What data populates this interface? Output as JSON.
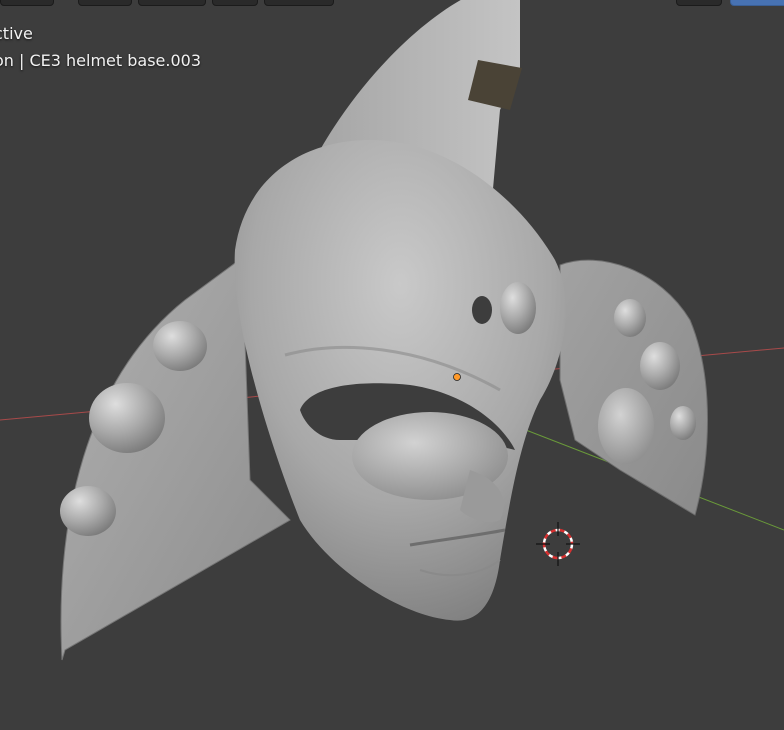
{
  "viewport": {
    "mode_text": "ctive",
    "object_text": "on | CE3 helmet base.003"
  },
  "colors": {
    "background": "#3d3d3d",
    "axis_x": "#a84a4a",
    "axis_y": "#6a9a3a",
    "mesh": "#a3a3a3",
    "origin": "#ff9a2a",
    "header_active": "#4772b3"
  },
  "icons": {
    "cursor": "3d-cursor-icon",
    "origin": "object-origin-icon"
  }
}
